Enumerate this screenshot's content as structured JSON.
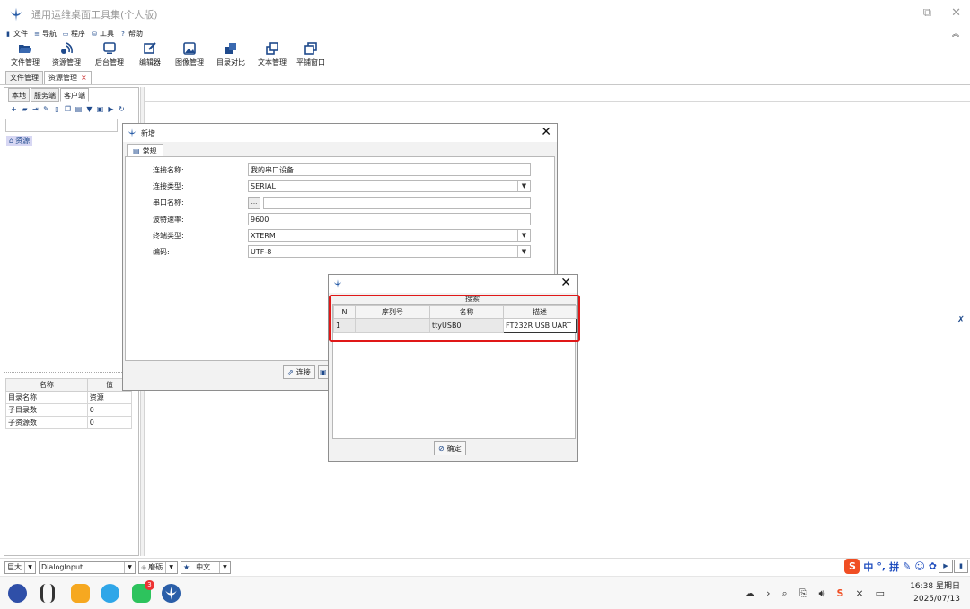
{
  "window": {
    "title": "通用运维桌面工具集(个人版)",
    "controls": [
      "–",
      "⧉",
      "✕"
    ]
  },
  "menu": [
    {
      "icon": "file-icon",
      "label": "文件"
    },
    {
      "icon": "hamburger-icon",
      "label": "导航"
    },
    {
      "icon": "program-icon",
      "label": "程序"
    },
    {
      "icon": "tools-icon",
      "label": "工具"
    },
    {
      "icon": "help-icon",
      "label": "帮助"
    }
  ],
  "toolbar": [
    {
      "label": "文件管理",
      "icon": "folder-open-icon"
    },
    {
      "label": "资源管理",
      "icon": "resource-icon"
    },
    {
      "label": "后台管理",
      "icon": "monitor-icon"
    },
    {
      "label": "编辑器",
      "icon": "editor-icon"
    },
    {
      "label": "图像管理",
      "icon": "image-icon"
    },
    {
      "label": "目录对比",
      "icon": "folder-compare-icon"
    },
    {
      "label": "文本管理",
      "icon": "text-compare-icon"
    },
    {
      "label": "平铺窗口",
      "icon": "tile-window-icon"
    }
  ],
  "doc_tabs": [
    {
      "label": "文件管理"
    },
    {
      "label": "资源管理",
      "close": "×"
    }
  ],
  "left_tabs": [
    "本地",
    "服务端",
    "客户端"
  ],
  "tree_root": "资源",
  "props": {
    "header": [
      "名称",
      "值"
    ],
    "rows": [
      [
        "目录名称",
        "资源"
      ],
      [
        "子目录数",
        "0"
      ],
      [
        "子资源数",
        "0"
      ]
    ]
  },
  "dialog_new": {
    "title": "新增",
    "tab": "常规",
    "fields": {
      "conn_name": {
        "label": "连接名称:",
        "value": "我的串口设备"
      },
      "conn_type": {
        "label": "连接类型:",
        "value": "SERIAL"
      },
      "port_name": {
        "label": "串口名称:",
        "value": "",
        "browse": "..."
      },
      "baud": {
        "label": "波特速率:",
        "value": "9600"
      },
      "term": {
        "label": "终端类型:",
        "value": "XTERM"
      },
      "encoding": {
        "label": "编码:",
        "value": "UTF-8"
      }
    },
    "connect_button": "连接",
    "second_button_partial": ""
  },
  "dialog_serial": {
    "search_label": "搜索",
    "columns": [
      "N",
      "序列号",
      "名称",
      "描述"
    ],
    "rows": [
      [
        "1",
        "",
        "ttyUSB0",
        "FT232R USB UART"
      ]
    ],
    "ok_button": "确定"
  },
  "statusbar": {
    "font_size": "巨大",
    "input_class": "DialogInput",
    "style": "磨砺",
    "language": "中文"
  },
  "ime": {
    "s": "S",
    "items": [
      "中",
      "°,",
      "拼",
      "✎",
      "☺",
      "✿"
    ]
  },
  "taskbar": {
    "clock_time": "16:38 星期日",
    "clock_date": "2025/07/13",
    "badge": "3"
  },
  "colors": {
    "accent": "#1f4a8c",
    "highlight_red": "#e01818",
    "selection": "#d7d7f3"
  }
}
